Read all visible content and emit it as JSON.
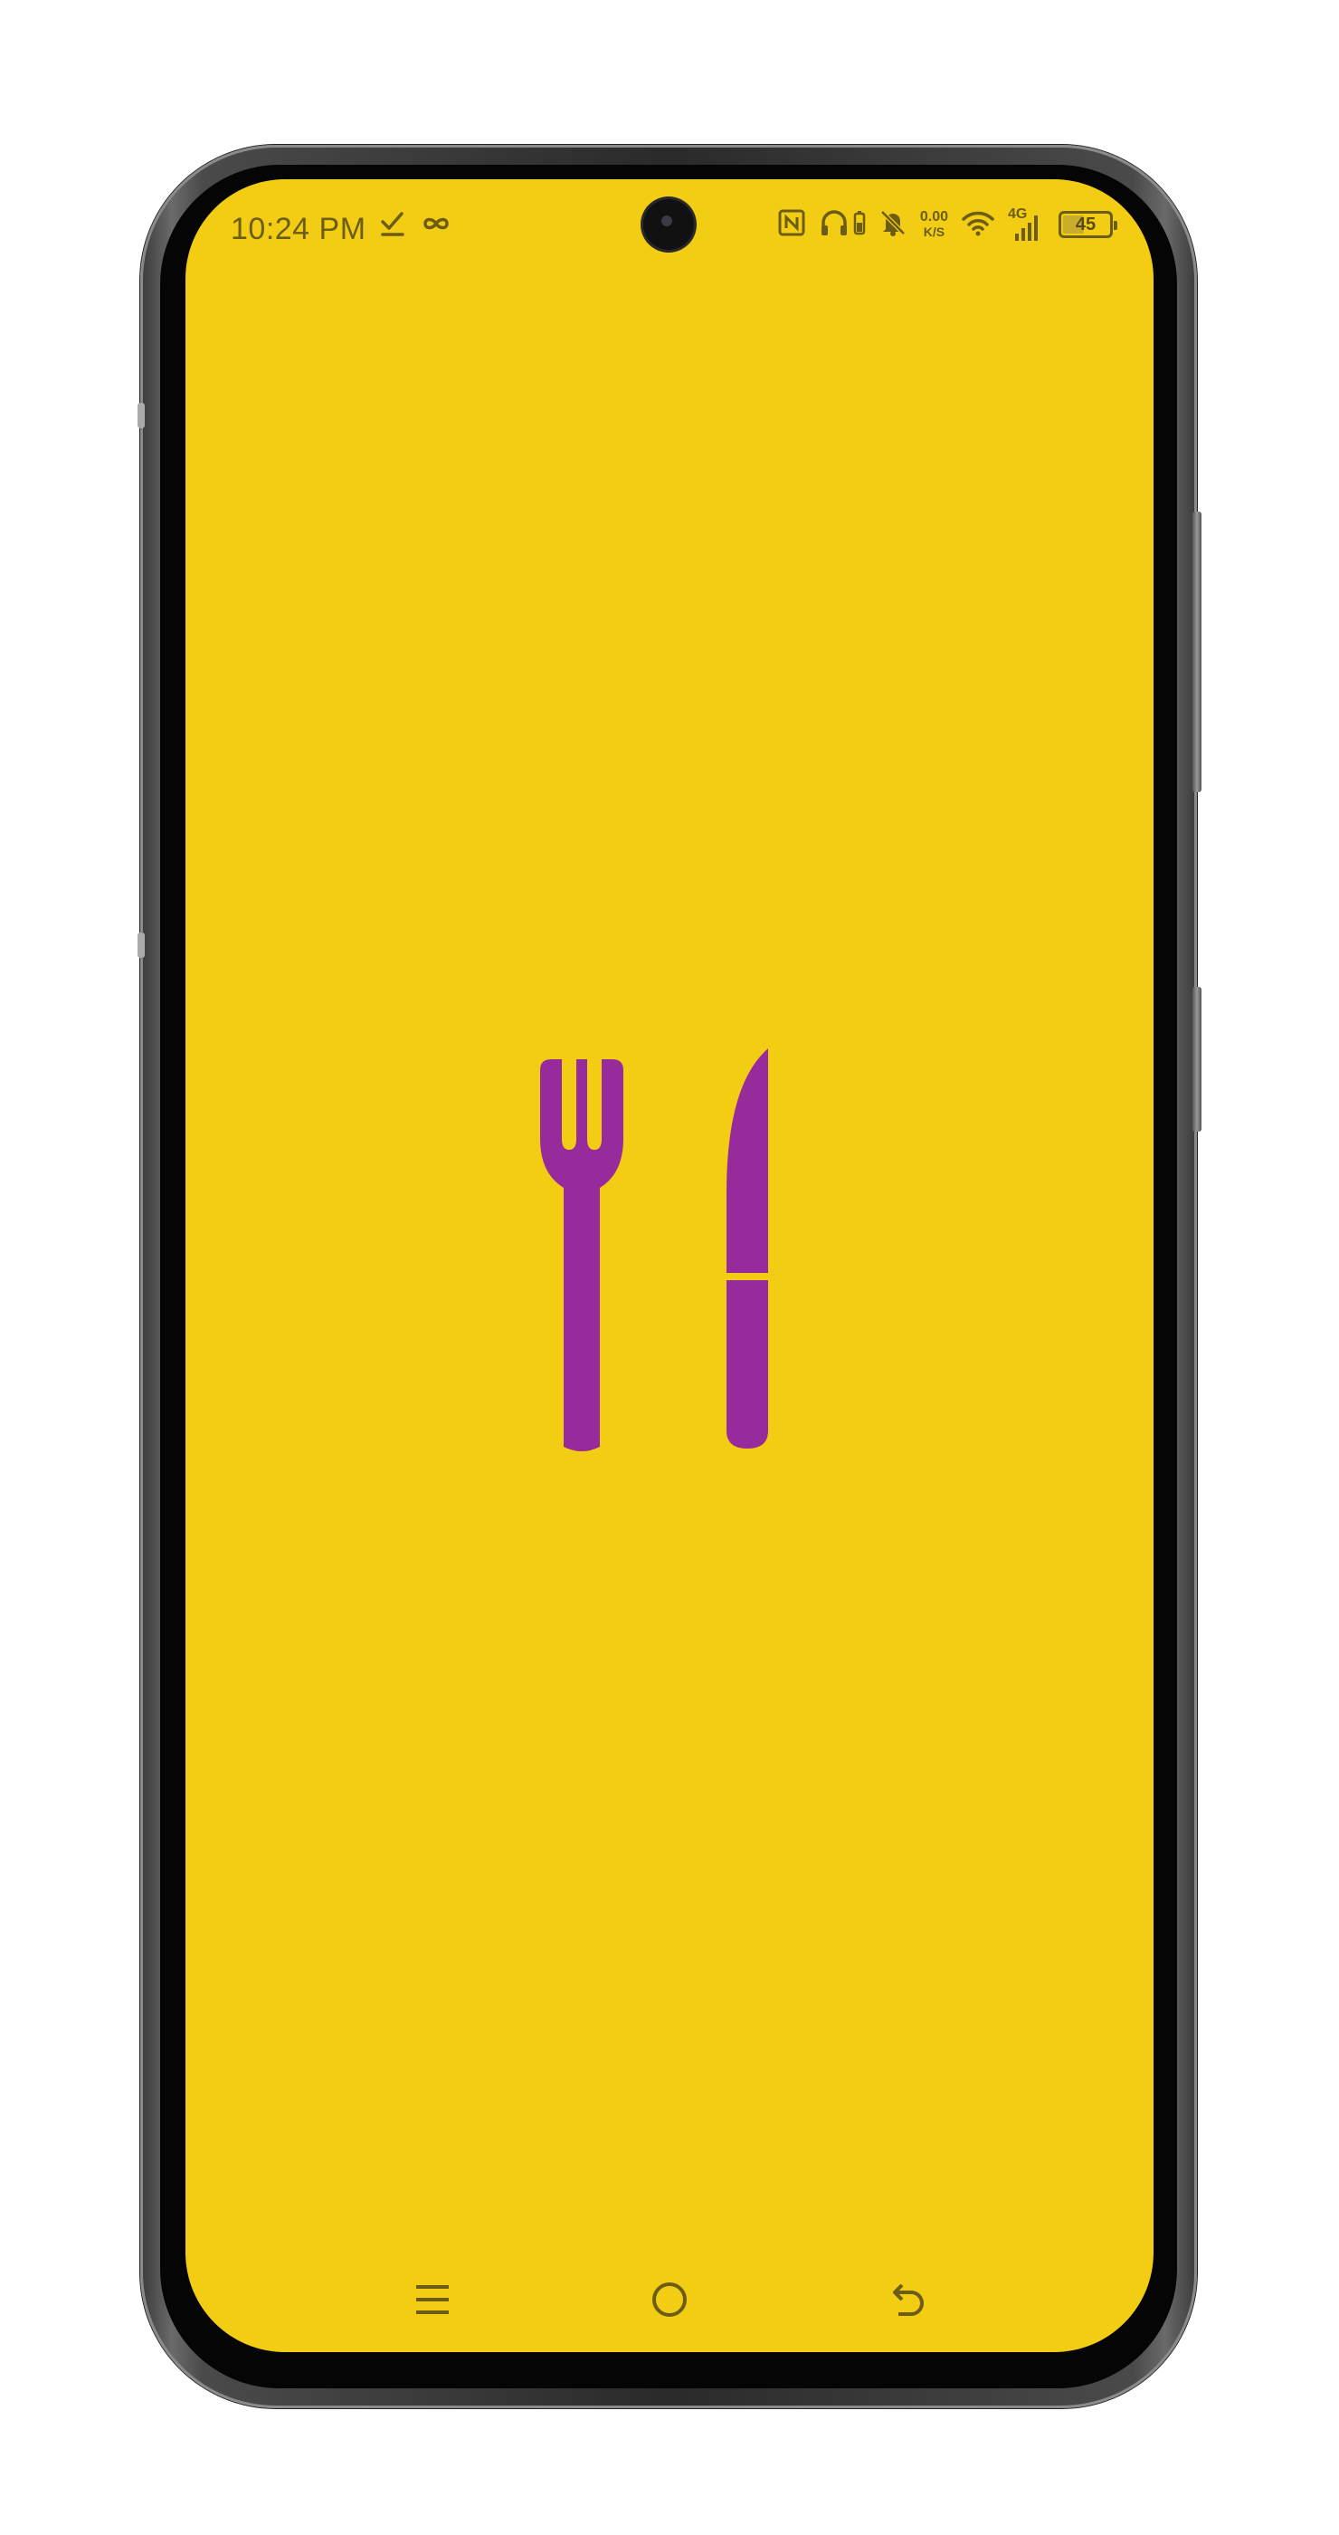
{
  "status_bar": {
    "time": "10:24 PM",
    "network_speed_value": "0.00",
    "network_speed_unit": "K/S",
    "network_type": "4G",
    "battery_level": "45",
    "battery_fraction": 0.45,
    "left_icons": [
      "checkmark-download-icon",
      "infinity-icon"
    ],
    "right_icons": [
      "nfc-icon",
      "headphones-icon",
      "battery-saver-icon",
      "muted-bell-icon",
      "wifi-icon",
      "signal-icon"
    ]
  },
  "splash": {
    "icon": "fork-and-knife-icon",
    "icon_color": "#972B9C",
    "background_color": "#F3CD14"
  },
  "nav_bar": {
    "buttons": [
      "menu-icon",
      "home-icon",
      "back-icon"
    ]
  }
}
